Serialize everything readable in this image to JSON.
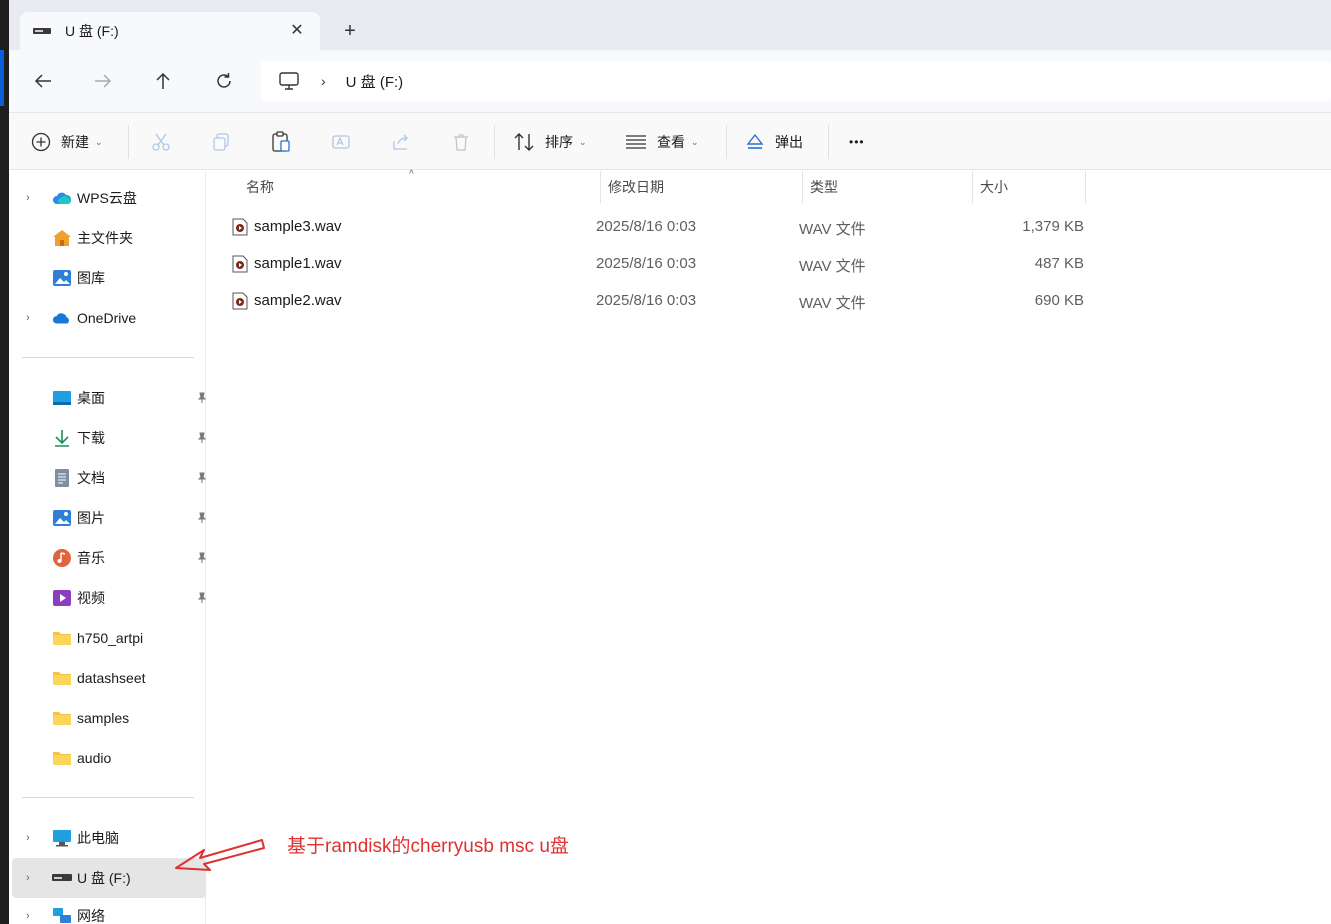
{
  "window": {
    "tab_title": "U 盘 (F:)",
    "new_tab": "+",
    "close": "✕"
  },
  "address_bar": {
    "separator": "›",
    "path": "U 盘 (F:)"
  },
  "toolbar": {
    "new_label": "新建",
    "sort_label": "排序",
    "view_label": "查看",
    "eject_label": "弹出",
    "more_label": "•••"
  },
  "sidebar": {
    "group1": [
      {
        "label": "WPS云盘",
        "icon": "cloud-icon",
        "expandable": true
      },
      {
        "label": "主文件夹",
        "icon": "home-icon",
        "expandable": false
      },
      {
        "label": "图库",
        "icon": "gallery-icon",
        "expandable": false
      },
      {
        "label": "OneDrive",
        "icon": "onedrive-icon",
        "expandable": true
      }
    ],
    "group2": [
      {
        "label": "桌面",
        "icon": "desktop-icon",
        "pinned": true
      },
      {
        "label": "下载",
        "icon": "download-icon",
        "pinned": true
      },
      {
        "label": "文档",
        "icon": "documents-icon",
        "pinned": true
      },
      {
        "label": "图片",
        "icon": "pictures-icon",
        "pinned": true
      },
      {
        "label": "音乐",
        "icon": "music-icon",
        "pinned": true
      },
      {
        "label": "视频",
        "icon": "videos-icon",
        "pinned": true
      },
      {
        "label": "h750_artpi",
        "icon": "folder-icon",
        "pinned": false
      },
      {
        "label": "datashseet",
        "icon": "folder-icon",
        "pinned": false
      },
      {
        "label": "samples",
        "icon": "folder-icon",
        "pinned": false
      },
      {
        "label": "audio",
        "icon": "folder-icon",
        "pinned": false
      }
    ],
    "group3": [
      {
        "label": "此电脑",
        "icon": "this-pc-icon",
        "expandable": true
      },
      {
        "label": "U 盘 (F:)",
        "icon": "usb-drive-icon",
        "expandable": true,
        "selected": true
      },
      {
        "label": "网络",
        "icon": "network-icon",
        "expandable": true
      }
    ]
  },
  "file_list": {
    "columns": {
      "name": "名称",
      "modified": "修改日期",
      "type": "类型",
      "size": "大小"
    },
    "rows": [
      {
        "name": "sample3.wav",
        "modified": "2025/8/16 0:03",
        "type": "WAV 文件",
        "size": "1,379 KB"
      },
      {
        "name": "sample1.wav",
        "modified": "2025/8/16 0:03",
        "type": "WAV 文件",
        "size": "487 KB"
      },
      {
        "name": "sample2.wav",
        "modified": "2025/8/16 0:03",
        "type": "WAV 文件",
        "size": "690 KB"
      }
    ]
  },
  "annotation": {
    "text": "基于ramdisk的cherryusb msc u盘",
    "color": "#e03131"
  }
}
